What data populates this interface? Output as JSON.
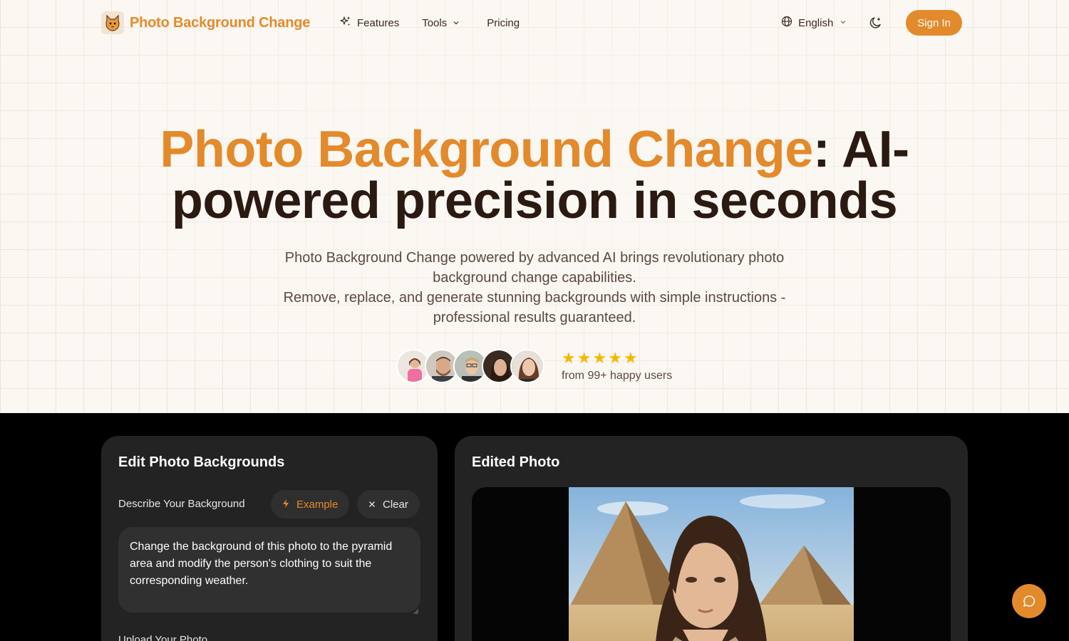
{
  "nav": {
    "brand": "Photo Background Change",
    "links": [
      {
        "label": "Features",
        "icon": "sparkles-icon"
      },
      {
        "label": "Tools",
        "icon": "chevron-down-icon"
      },
      {
        "label": "Pricing"
      }
    ],
    "language": "English",
    "sign_in": "Sign In"
  },
  "hero": {
    "headline_accent": "Photo Background Change",
    "headline_rest": ": AI-powered precision in seconds",
    "subtitle_line1": "Photo Background Change powered by advanced AI brings revolutionary photo background change capabilities.",
    "subtitle_line2": "Remove, replace, and generate stunning backgrounds with simple instructions - professional results guaranteed.",
    "rating_stars": 5,
    "rating_text": "from 99+ happy users"
  },
  "editor": {
    "title": "Edit Photo Backgrounds",
    "describe_label": "Describe Your Background",
    "example_button": "Example",
    "clear_button": "Clear",
    "prompt_value": "Change the background of this photo to the pyramid area and modify the person's clothing to suit the corresponding weather.",
    "upload_label": "Upload Your Photo"
  },
  "result": {
    "title": "Edited Photo"
  },
  "colors": {
    "accent": "#e38a2c",
    "hero_bg": "#fbf7f2",
    "panel_bg": "#232323",
    "star": "#f5b800"
  }
}
